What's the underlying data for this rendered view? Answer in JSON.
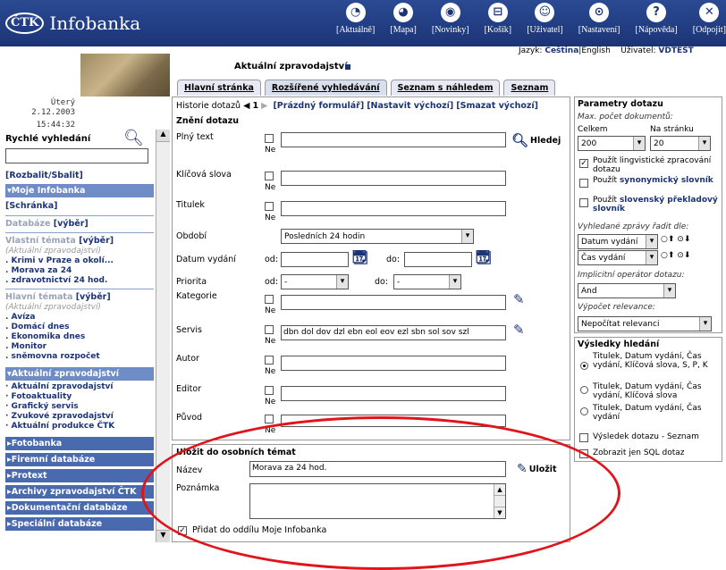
{
  "header": {
    "brand_badge": "ČTK",
    "brand_name": "Infobanka",
    "nav": [
      {
        "icon": "clock-icon",
        "glyph": "◔",
        "label": "[Aktuálně]"
      },
      {
        "icon": "globe-icon",
        "glyph": "◕",
        "label": "[Mapa]"
      },
      {
        "icon": "news-icon",
        "glyph": "◉",
        "label": "[Novinky]"
      },
      {
        "icon": "cart-icon",
        "glyph": "⊟",
        "label": "[Košík]"
      },
      {
        "icon": "user-icon",
        "glyph": "☺",
        "label": "[Uživatel]"
      },
      {
        "icon": "settings-icon",
        "glyph": "⊙",
        "label": "[Nastavení]"
      },
      {
        "icon": "help-icon",
        "glyph": "?",
        "label": "[Nápověda]"
      },
      {
        "icon": "logout-icon",
        "glyph": "✕",
        "label": "[Odpojit]"
      }
    ],
    "lang_prefix": "Jazyk:",
    "lang_current": "Čeština",
    "lang_sep": "|English",
    "user_prefix": "Uživatel:",
    "user_name": "VDTEST"
  },
  "date_box": {
    "weekday": "Úterý",
    "date": "2.12.2003",
    "time": "15:44:32"
  },
  "section_title": "Aktuální zpravodajství",
  "quick_search": {
    "label": "Rychlé vyhledání"
  },
  "sidebar": {
    "toggle": "[Rozbalit/Sbalit]",
    "moje_head": "▾Moje Infobanka",
    "schranka": "[Schránka]",
    "databaze": "Databáze",
    "databaze_pick": "[výběr]",
    "vlastni": "Vlastní témata",
    "vlastni_pick": "[výběr]",
    "vlastni_sub": "(Aktuální zpravodajství)",
    "vlastni_items": [
      ". Krimi v Praze a okolí...",
      ". Morava za 24",
      ". zdravotnictví 24 hod."
    ],
    "hlavni": "Hlavní témata",
    "hlavni_pick": "[výběr]",
    "hlavni_sub": "(Aktuální zpravodajství)",
    "hlavni_items": [
      ". Avíza",
      ". Domácí dnes",
      ". Ekonomika dnes",
      ". Monitor",
      ". sněmovna rozpočet"
    ],
    "aktualni_head": "▾Aktuální zpravodajství",
    "aktualni_items": [
      "· Aktuální zpravodajství",
      "· Fotoaktuality",
      "· Grafický servis",
      "· Zvukové zpravodajství",
      "· Aktuální produkce ČTK"
    ],
    "collapsed": [
      "▸Fotobanka",
      "▸Firemní databáze",
      "▸Protext",
      "▸Archivy zpravodajství ČTK",
      "▸Dokumentační databáze",
      "▸Speciální databáze"
    ]
  },
  "tabs": [
    "Hlavní stránka",
    "Rozšířené vyhledávání",
    "Seznam s náhledem",
    "Seznam"
  ],
  "history": {
    "label": "Historie dotazů",
    "left": "◀",
    "page": "1",
    "right": "▶",
    "empty_form": "[Prázdný formulář]",
    "set_default": "[Nastavit výchozí]",
    "clear_default": "[Smazat výchozí]"
  },
  "form": {
    "title": "Znění dotazu",
    "ne": "Ne",
    "fulltext": "Plný text",
    "search_btn": "Hledej",
    "keywords": "Klíčová slova",
    "titulek": "Titulek",
    "obdobi": "Období",
    "obdobi_value": "Posledních 24 hodin",
    "datum": "Datum vydání",
    "od": "od:",
    "do": "do:",
    "priorita": "Priorita",
    "priorita_od_value": "-",
    "priorita_do_value": "-",
    "kategorie": "Kategorie",
    "servis": "Servis",
    "servis_value": "dbn dol dov dzl ebn eol eov ezl sbn sol sov szl",
    "autor": "Autor",
    "editor": "Editor",
    "puvod": "Původ"
  },
  "save": {
    "title": "Uložit do osobních témat",
    "name_label": "Název",
    "name_value": "Morava za 24 hod.",
    "save_btn": "Uložit",
    "note_label": "Poznámka",
    "add_label": "Přidat do oddílu Moje Infobanka"
  },
  "params": {
    "title": "Parametry dotazu",
    "max_label": "Max. počet dokumentů:",
    "celkem": "Celkem",
    "per_page": "Na stránku",
    "celkem_value": "200",
    "per_page_value": "20",
    "opt_ling": "Použít lingvistické zpracování dotazu",
    "opt_syn_prefix": "Použít",
    "opt_syn": "synonymický slovník",
    "opt_slov_prefix": "Použít",
    "opt_slov": "slovenský překladový slovník",
    "sort_label": "Vyhledané zprávy řadit dle:",
    "sort1": "Datum vydání",
    "sort2": "Čas vydání",
    "operator_label": "Implicitní operátor dotazu:",
    "operator_value": "And",
    "relevance_label": "Výpočet relevance:",
    "relevance_value": "Nepočítat relevanci"
  },
  "results": {
    "title": "Výsledky hledání",
    "opt1": "Titulek, Datum vydání, Čas vydání, Klíčová slova, S, P, K",
    "opt2": "Titulek, Datum vydání, Čas vydání, Klíčová slova",
    "opt3": "Titulek, Datum vydání, Čas vydání",
    "chk1": "Výsledek dotazu - Seznam",
    "chk2": "Zobrazit jen SQL dotaz"
  },
  "colors": {
    "header_bg": "#1c3476",
    "link": "#1c3476",
    "sidebar_head": "#6e8cc6",
    "annotation": "#e0141a"
  }
}
